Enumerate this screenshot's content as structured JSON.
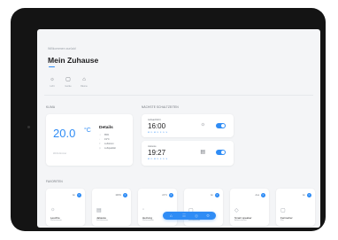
{
  "header": {
    "welcome": "Willkommen zurück!",
    "title": "Mein Zuhause"
  },
  "quick_actions": [
    {
      "icon": "☼",
      "label": "Licht"
    },
    {
      "icon": "▢",
      "label": "Geräte"
    },
    {
      "icon": "⌂",
      "label": "Räume"
    }
  ],
  "climate": {
    "section_label": "KLIMA",
    "temperature": "20.0",
    "unit": "°C",
    "details_title": "Details",
    "details": [
      {
        "icon": "☼",
        "text": "85%"
      },
      {
        "icon": "◦",
        "text": "19°C"
      },
      {
        "icon": "≈",
        "text": "Luftstrom"
      },
      {
        "icon": "◇",
        "text": "Luftqualität"
      }
    ],
    "footer": "Wohnzimmer"
  },
  "alarms": {
    "section_label": "NÄCHSTE SCHALTZEITEN",
    "items": [
      {
        "label": "Aufwachlicht",
        "time": "16:00",
        "days": "M D M D F S S",
        "icon": "☼",
        "on": true
      },
      {
        "label": "Jalousie",
        "time": "19:27",
        "days": "M D M D F S S",
        "icon": "▤",
        "on": true
      }
    ]
  },
  "favorites": {
    "section_label": "FAVORITEN",
    "items": [
      {
        "state": "An",
        "icon": "☼",
        "name": "Leuchte",
        "room": "Wohnzimmer"
      },
      {
        "state": "100%",
        "icon": "▤",
        "name": "Jalousie",
        "room": "Schlafzimmer"
      },
      {
        "state": "21°C",
        "icon": "◦",
        "name": "Heizung",
        "room": "Wohnzimmer"
      },
      {
        "state": "An",
        "icon": "▢",
        "name": "",
        "room": "Schlafzimmer"
      },
      {
        "state": "Aus",
        "icon": "◇",
        "name": "Smart speaker",
        "room": "Arbeitszimmer"
      },
      {
        "state": "An",
        "icon": "▢",
        "name": "Fernseher",
        "room": "Flur"
      }
    ]
  },
  "tabbar": {
    "tabs": [
      "⌂",
      "☰",
      "◎",
      "⚙"
    ]
  },
  "colors": {
    "accent": "#2f8cf5",
    "background": "#f4f5f7",
    "bezel": "#141414"
  }
}
